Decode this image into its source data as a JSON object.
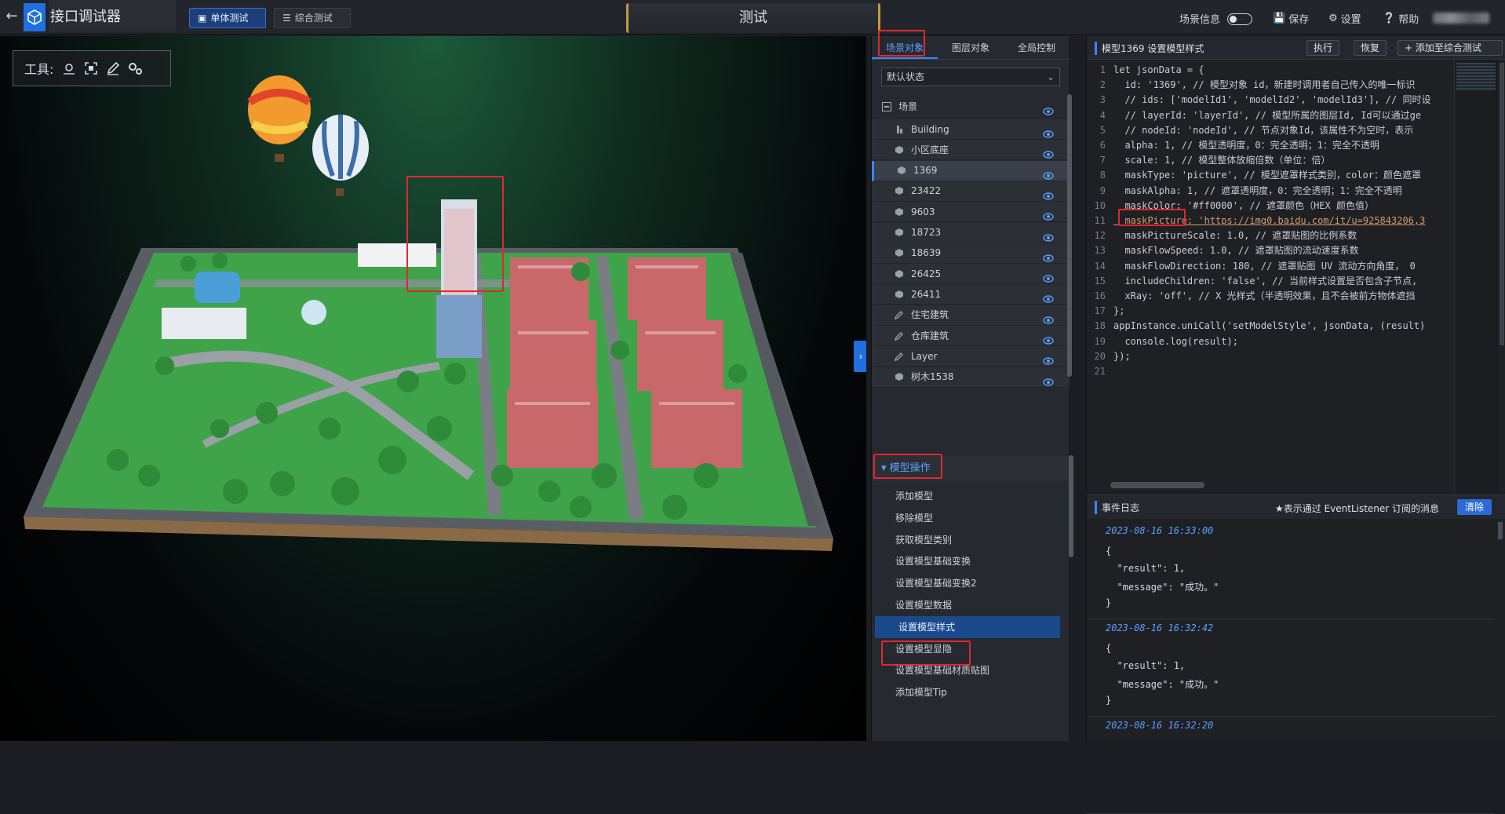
{
  "header": {
    "app_title": "接口调试器",
    "mode_single": "单体测试",
    "mode_combo": "综合测试",
    "center_title": "测试",
    "scene_info": "场景信息",
    "save": "保存",
    "settings": "设置",
    "help": "帮助"
  },
  "viewport": {
    "toolbar_label": "工具:"
  },
  "mid": {
    "tabs": [
      "场景对象",
      "图层对象",
      "全局控制"
    ],
    "state_select": "默认状态",
    "tree_root": "场景",
    "tree_items": [
      "Building",
      "小区底座",
      "1369",
      "23422",
      "9603",
      "18723",
      "18639",
      "26425",
      "26411",
      "住宅建筑",
      "仓库建筑",
      "Layer",
      "树木1538"
    ],
    "ops_header": "模型操作",
    "ops": [
      "添加模型",
      "移除模型",
      "获取模型类别",
      "设置模型基础变换",
      "设置模型基础变换2",
      "设置模型数据",
      "设置模型样式",
      "设置模型显隐",
      "设置模型基础材质贴图",
      "添加模型Tip"
    ]
  },
  "code": {
    "title": "模型1369 设置模型样式",
    "run": "执行",
    "restore": "恢复",
    "add_combo": "添加至综合测试",
    "line_numbers": [
      "1",
      "2",
      "3",
      "4",
      "5",
      "6",
      "7",
      "8",
      "9",
      "10",
      "11",
      "12",
      "13",
      "14",
      "15",
      "16",
      "17",
      "18",
      "19",
      "20",
      "21"
    ],
    "lines": [
      "let jsonData = {",
      "  id: '1369', // 模型对象 id，新建时调用者自己传入的唯一标识",
      "  // ids: ['modelId1', 'modelId2', 'modelId3'], // 同时设",
      "  // layerId: 'layerId', // 模型所属的图层Id, Id可以通过ge",
      "  // nodeId: 'nodeId', // 节点对象Id，该属性不为空时，表示",
      "  alpha: 1, // 模型透明度，0：完全透明；1：完全不透明",
      "  scale: 1, // 模型整体放缩倍数（单位：倍）",
      "  maskType: 'picture', // 模型遮罩样式类别，color：颜色遮罩",
      "  maskAlpha: 1, // 遮罩透明度，0：完全透明；1：完全不透明",
      "  maskColor: '#ff0000', // 遮罩颜色（HEX 颜色值）",
      "  maskPicture: 'https://img0.baidu.com/it/u=925843206,3",
      "  maskPictureScale: 1.0, // 遮罩贴图的比例系数",
      "  maskFlowSpeed: 1.0, // 遮罩贴图的流动速度系数",
      "  maskFlowDirection: 180, // 遮罩贴图 UV 流动方向角度， 0",
      "  includeChildren: 'false', // 当前样式设置是否包含子节点,",
      "  xRay: 'off', // X 光样式（半透明效果，且不会被前方物体遮挡",
      "};",
      "appInstance.uniCall('setModelStyle', jsonData, (result)",
      "  console.log(result);",
      "});",
      ""
    ]
  },
  "log": {
    "title": "事件日志",
    "note": "★表示通过 EventListener 订阅的消息",
    "clear": "清除",
    "entries": [
      {
        "time": "2023-08-16 16:33:00",
        "l1": "{",
        "l2": "  \"result\": 1,",
        "l3": "  \"message\": \"成功。\"",
        "l4": "}"
      },
      {
        "time": "2023-08-16 16:32:42",
        "l1": "{",
        "l2": "  \"result\": 1,",
        "l3": "  \"message\": \"成功。\"",
        "l4": "}"
      },
      {
        "time": "2023-08-16 16:32:20"
      }
    ]
  },
  "colors": {
    "accent": "#3a86ff",
    "highlight_box": "#e0282e",
    "active_op": "#1a4a8c"
  }
}
